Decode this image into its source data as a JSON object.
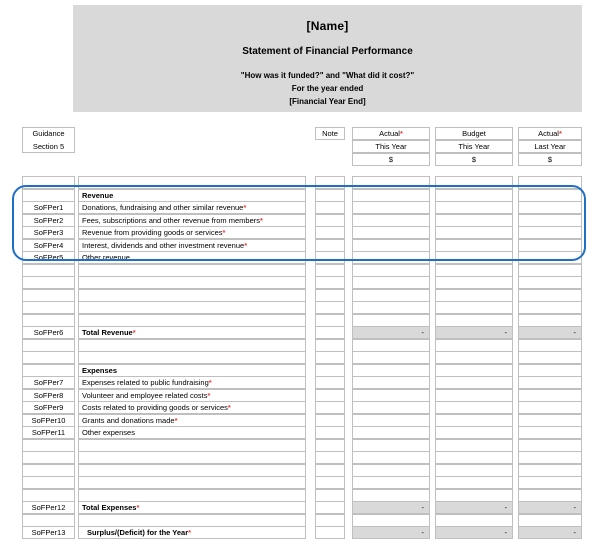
{
  "header": {
    "entity_name": "[Name]",
    "statement_title": "Statement of Financial Performance",
    "subtitle_line1": "\"How was it funded?\" and \"What did it cost?\"",
    "subtitle_line2": "For the year ended",
    "subtitle_line3": "[Financial Year End]"
  },
  "guidance": {
    "line1": "Guidance",
    "line2": "Section 5"
  },
  "columns": {
    "note": "Note",
    "actual_this_year": {
      "title": "Actual",
      "required": "*",
      "period": "This Year",
      "currency": "$"
    },
    "budget_this_year": {
      "title": "Budget",
      "required": "",
      "period": "This Year",
      "currency": "$"
    },
    "actual_last_year": {
      "title": "Actual",
      "required": "*",
      "period": "Last Year",
      "currency": "$"
    }
  },
  "dash": "-",
  "sections": [
    {
      "heading": "Revenue",
      "rows": [
        {
          "ref": "SoFPer1",
          "label": "Donations, fundraising and other similar revenue",
          "required": true
        },
        {
          "ref": "SoFPer2",
          "label": "Fees, subscriptions and other revenue from members",
          "required": true
        },
        {
          "ref": "SoFPer3",
          "label": "Revenue from providing goods or services",
          "required": true
        },
        {
          "ref": "SoFPer4",
          "label": "Interest, dividends and other investment revenue",
          "required": true
        },
        {
          "ref": "SoFPer5",
          "label": "Other revenue",
          "required": false
        }
      ],
      "total": {
        "ref": "SoFPer6",
        "label": "Total Revenue",
        "required": true
      }
    },
    {
      "heading": "Expenses",
      "rows": [
        {
          "ref": "SoFPer7",
          "label": "Expenses related to public fundraising",
          "required": true
        },
        {
          "ref": "SoFPer8",
          "label": "Volunteer and employee related costs",
          "required": true
        },
        {
          "ref": "SoFPer9",
          "label": "Costs related to providing goods or services",
          "required": true
        },
        {
          "ref": "SoFPer10",
          "label": "Grants and donations made",
          "required": true
        },
        {
          "ref": "SoFPer11",
          "label": "Other expenses",
          "required": false
        }
      ],
      "total": {
        "ref": "SoFPer12",
        "label": "Total Expenses",
        "required": true
      }
    }
  ],
  "surplus": {
    "ref": "SoFPer13",
    "label": "Surplus/(Deficit) for the Year",
    "required": true
  },
  "colors": {
    "highlight_border": "#1f6fc4",
    "band_background": "#d9d9d9",
    "shaded_cell": "#d9d9d9",
    "grid_line": "#bfbfbf",
    "required_marker": "#e8403a"
  }
}
